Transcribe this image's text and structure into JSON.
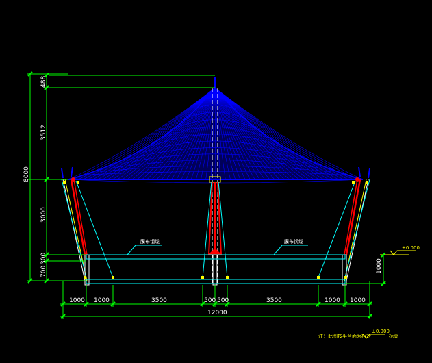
{
  "drawing": {
    "dimensions_vertical_left": [
      "8000",
      "488",
      "3512",
      "3000",
      "300",
      "700"
    ],
    "dimensions_vertical_right": [
      "1000"
    ],
    "dimensions_horizontal": [
      "1000",
      "1000",
      "3500",
      "500",
      "500",
      "3500",
      "1000",
      "1000"
    ],
    "overall_width": "12000",
    "label_left": "膜布钢缆",
    "label_right": "膜布钢缆",
    "elevation_mark": "±0.000",
    "note_prefix": "注：此图按平台面为相对",
    "note_elev": "±0.000",
    "note_suffix": "标高"
  },
  "colors": {
    "membrane": "#0000ff",
    "dimension": "#00ff00",
    "cable": "#00ffff",
    "mast": "#ff0000",
    "text": "#ffffff",
    "note": "#ffff00"
  }
}
